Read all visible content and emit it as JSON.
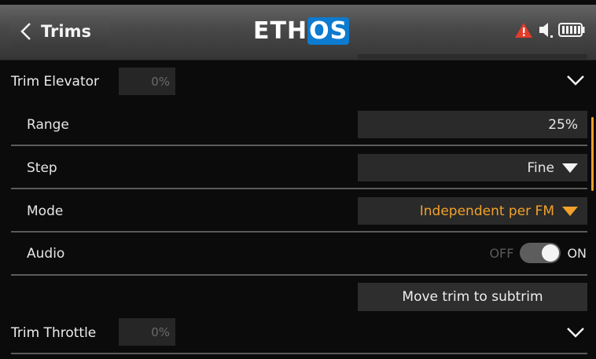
{
  "header": {
    "title": "Trims",
    "logo_main": "ETH",
    "logo_accent": "OS"
  },
  "trims": [
    {
      "label": "Trim Elevator",
      "value": "0%",
      "expanded": true,
      "settings": {
        "range_label": "Range",
        "range_value": "25%",
        "step_label": "Step",
        "step_value": "Fine",
        "mode_label": "Mode",
        "mode_value": "Independent per FM",
        "audio_label": "Audio",
        "audio_off": "OFF",
        "audio_on": "ON",
        "audio_enabled": true
      },
      "move_button": "Move trim to subtrim"
    },
    {
      "label": "Trim Throttle",
      "value": "0%",
      "expanded": false
    }
  ],
  "colors": {
    "accent": "#f2a12a",
    "warning": "#e53b2a",
    "logo_blue": "#0c7bd0"
  },
  "icons": [
    "back-chevron-icon",
    "warning-icon",
    "speaker-icon",
    "battery-icon",
    "chevron-down-icon",
    "dropdown-triangle-icon"
  ]
}
